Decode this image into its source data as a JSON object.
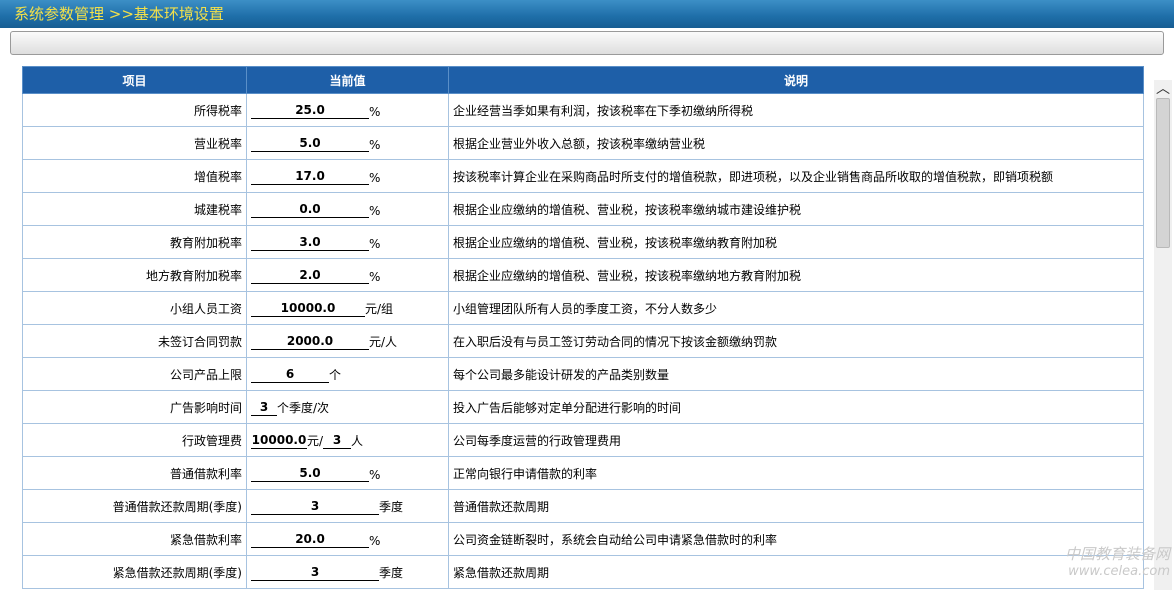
{
  "header": {
    "title": "系统参数管理",
    "breadcrumb": ">>基本环境设置"
  },
  "table": {
    "columns": [
      "项目",
      "当前值",
      "说明"
    ],
    "rows": [
      {
        "label": "所得税率",
        "value": "25.0",
        "unit": "%",
        "desc": "企业经营当季如果有利润，按该税率在下季初缴纳所得税"
      },
      {
        "label": "营业税率",
        "value": "5.0",
        "unit": "%",
        "desc": "根据企业营业外收入总额，按该税率缴纳营业税"
      },
      {
        "label": "增值税率",
        "value": "17.0",
        "unit": "%",
        "desc": "按该税率计算企业在采购商品时所支付的增值税款，即进项税，以及企业销售商品所收取的增值税款，即销项税额"
      },
      {
        "label": "城建税率",
        "value": "0.0",
        "unit": "%",
        "desc": "根据企业应缴纳的增值税、营业税，按该税率缴纳城市建设维护税"
      },
      {
        "label": "教育附加税率",
        "value": "3.0",
        "unit": "%",
        "desc": "根据企业应缴纳的增值税、营业税，按该税率缴纳教育附加税"
      },
      {
        "label": "地方教育附加税率",
        "value": "2.0",
        "unit": "%",
        "desc": "根据企业应缴纳的增值税、营业税，按该税率缴纳地方教育附加税"
      },
      {
        "label": "小组人员工资",
        "value": "10000.0",
        "unit": "元/组",
        "desc": "小组管理团队所有人员的季度工资，不分人数多少"
      },
      {
        "label": "未签订合同罚款",
        "value": "2000.0",
        "unit": "元/人",
        "desc": "在入职后没有与员工签订劳动合同的情况下按该金额缴纳罚款"
      },
      {
        "label": "公司产品上限",
        "value": "6",
        "unit": "个",
        "desc": "每个公司最多能设计研发的产品类别数量"
      },
      {
        "label": "广告影响时间",
        "value": "3",
        "unit": "个季度/次",
        "desc": "投入广告后能够对定单分配进行影响的时间"
      },
      {
        "label": "行政管理费",
        "value": "10000.0",
        "unit": "元/",
        "value2": "3",
        "unit2": "人",
        "desc": "公司每季度运营的行政管理费用"
      },
      {
        "label": "普通借款利率",
        "value": "5.0",
        "unit": "%",
        "desc": "正常向银行申请借款的利率"
      },
      {
        "label": "普通借款还款周期(季度)",
        "value": "3",
        "unit": "季度",
        "desc": "普通借款还款周期"
      },
      {
        "label": "紧急借款利率",
        "value": "20.0",
        "unit": "%",
        "desc": "公司资金链断裂时，系统会自动给公司申请紧急借款时的利率"
      },
      {
        "label": "紧急借款还款周期(季度)",
        "value": "3",
        "unit": "季度",
        "desc": "紧急借款还款周期"
      }
    ]
  },
  "watermark": {
    "line1": "中国教育装备网",
    "line2": "www.celea.com"
  }
}
